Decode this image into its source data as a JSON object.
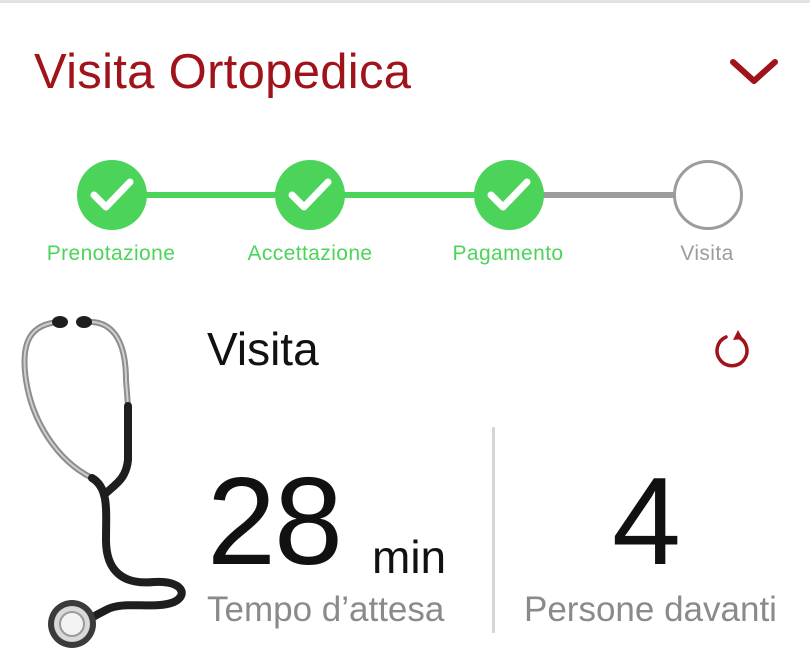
{
  "header": {
    "title": "Visita Ortopedica",
    "collapse_icon": "chevron-down-icon",
    "accent_color": "#a0131a"
  },
  "steps": [
    {
      "label": "Prenotazione",
      "status": "done"
    },
    {
      "label": "Accettazione",
      "status": "done"
    },
    {
      "label": "Pagamento",
      "status": "done"
    },
    {
      "label": "Visita",
      "status": "pending"
    }
  ],
  "colors": {
    "done": "#4cd45a",
    "pending": "#9c9c9c"
  },
  "card": {
    "image": "stethoscope-icon",
    "title": "Visita",
    "refresh_icon": "refresh-icon",
    "wait": {
      "value": "28",
      "unit": "min",
      "label": "Tempo d’attesa"
    },
    "people": {
      "value": "4",
      "label": "Persone davanti"
    }
  }
}
